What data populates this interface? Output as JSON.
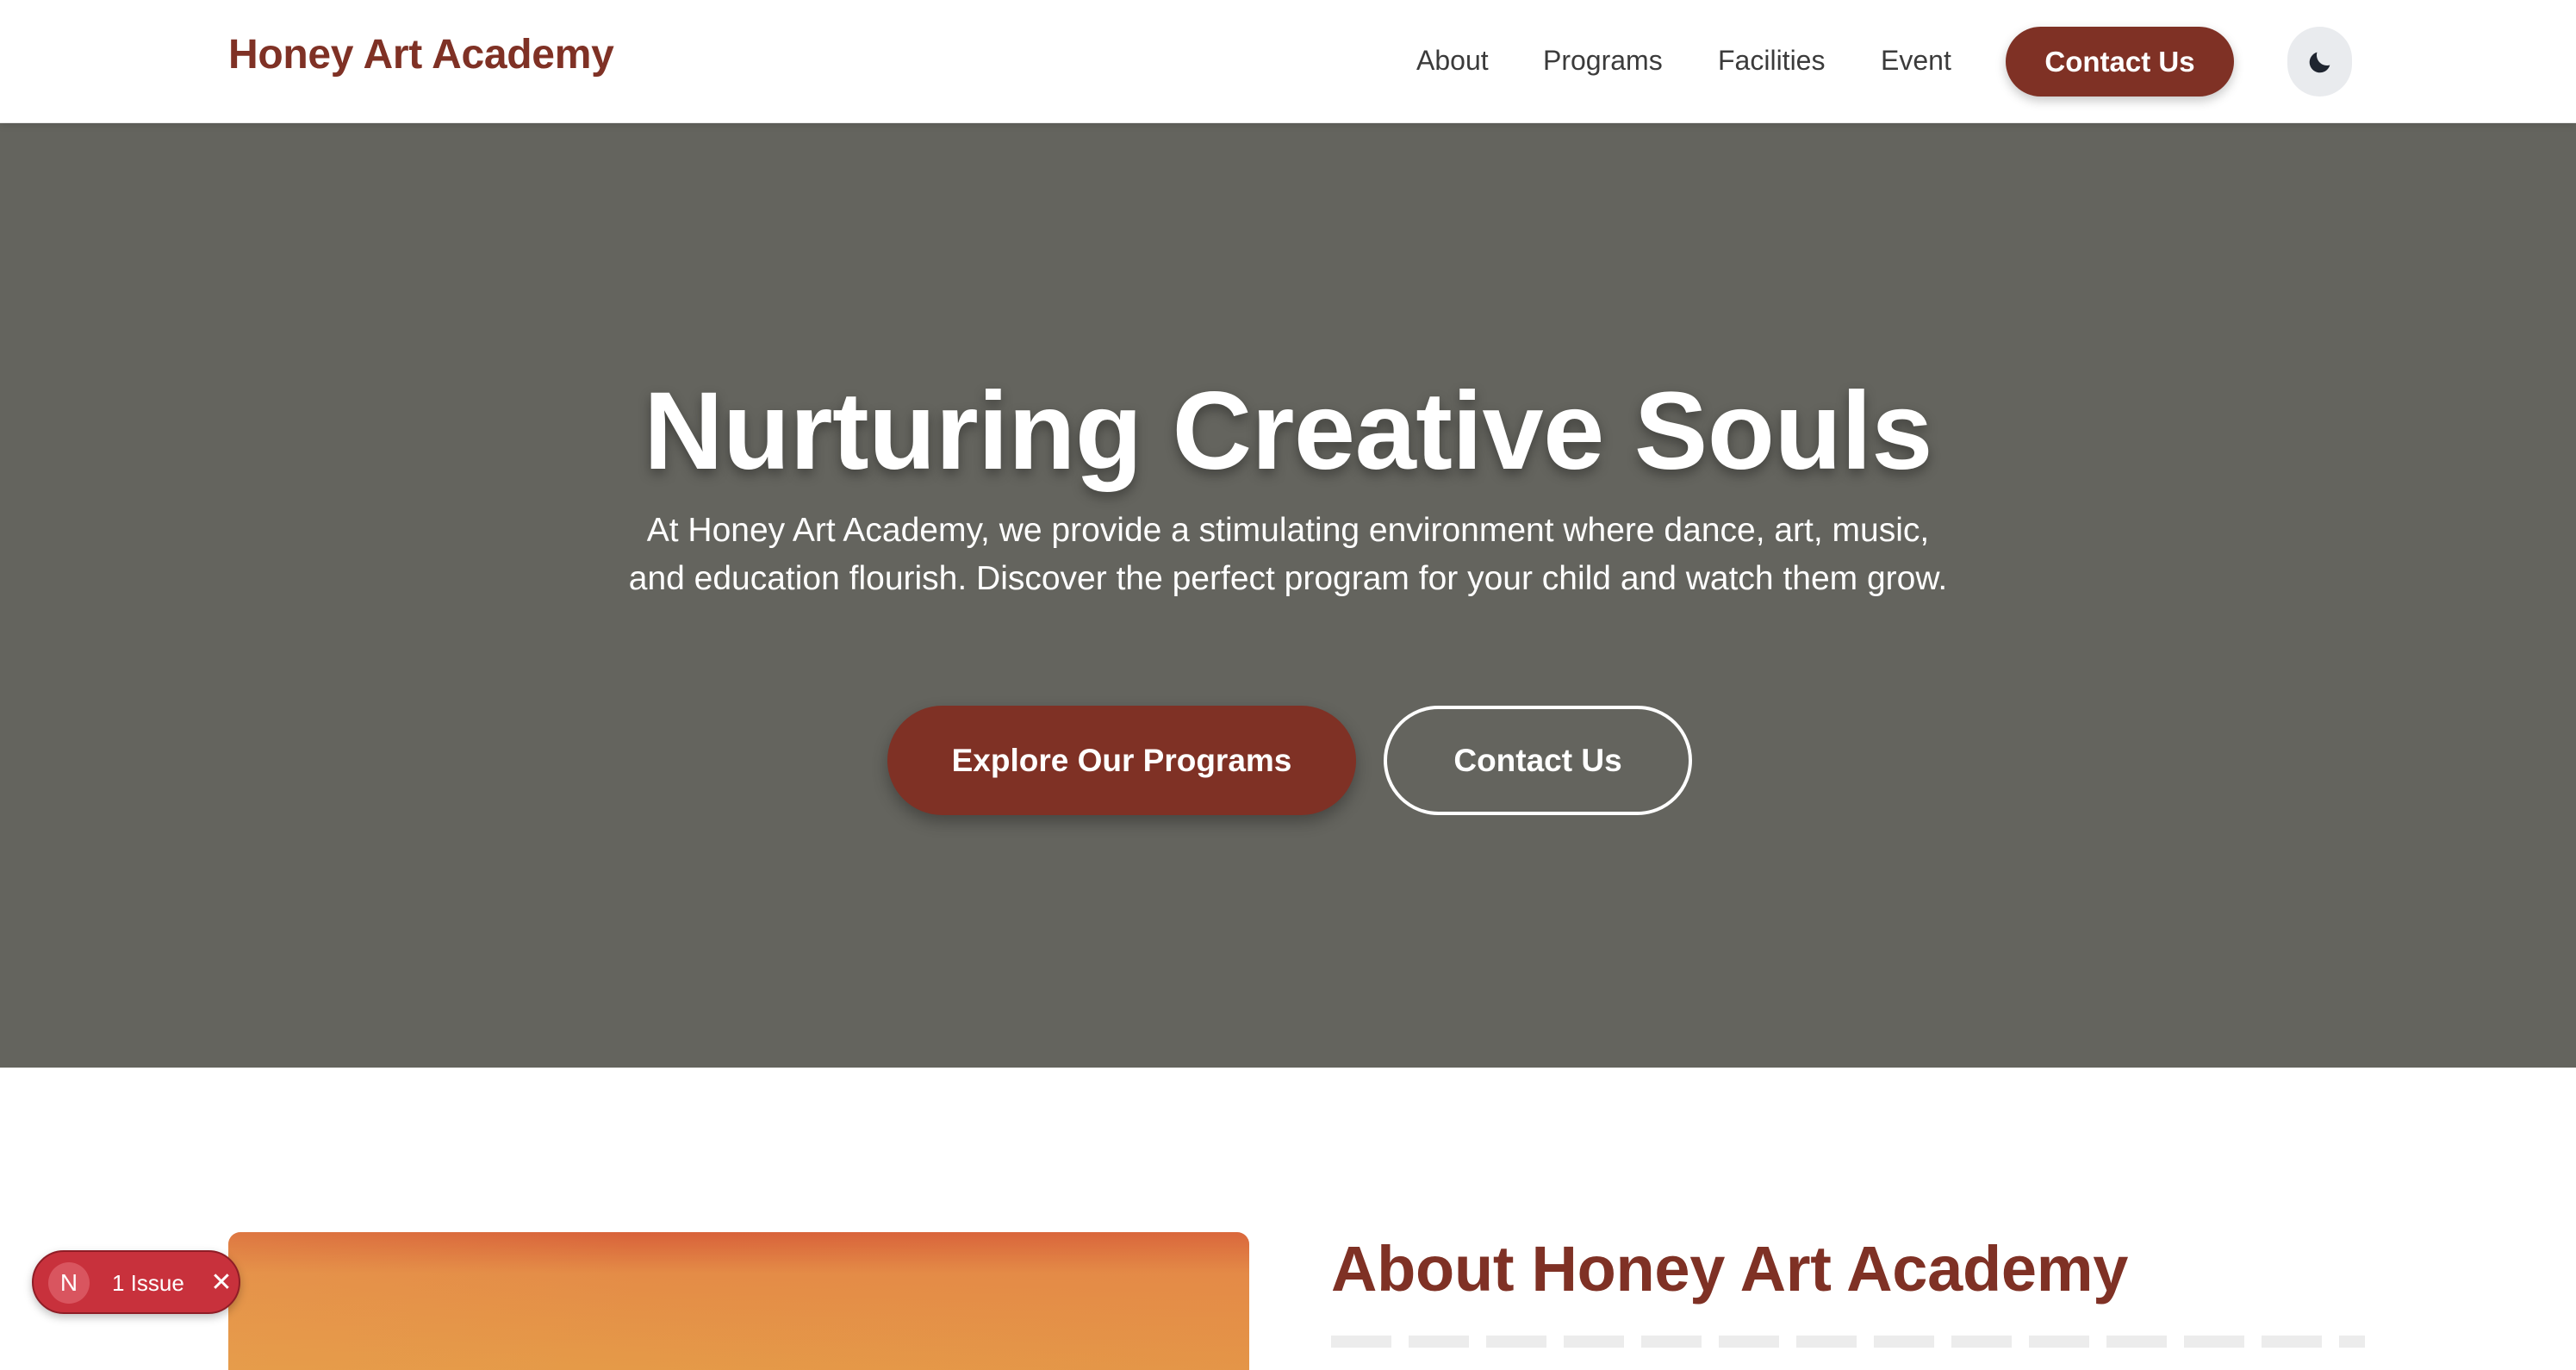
{
  "header": {
    "logo": "Honey Art Academy",
    "nav": [
      {
        "label": "About"
      },
      {
        "label": "Programs"
      },
      {
        "label": "Facilities"
      },
      {
        "label": "Event"
      }
    ],
    "contact_label": "Contact Us",
    "theme_icon": "moon-icon"
  },
  "hero": {
    "title": "Nurturing Creative Souls",
    "text": "At Honey Art Academy, we provide a stimulating environment where dance, art, music, and education flourish. Discover the perfect program for your child and watch them grow.",
    "primary_button": "Explore Our Programs",
    "secondary_button": "Contact Us"
  },
  "about": {
    "title": "About Honey Art Academy"
  },
  "dev_badge": {
    "logo_letter": "N",
    "label": "1 Issue",
    "close_icon": "close-icon"
  },
  "colors": {
    "brand": "#7f3125",
    "hero_bg": "#64645e",
    "badge": "#c8313c"
  }
}
